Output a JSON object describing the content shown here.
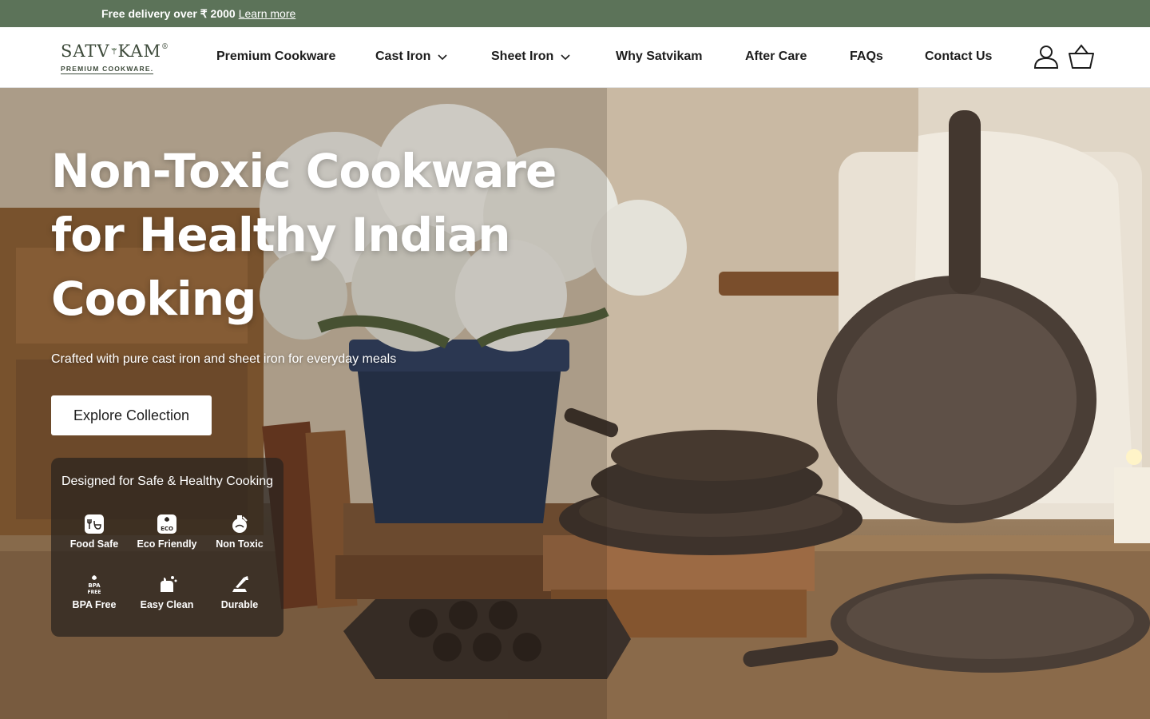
{
  "announcement": {
    "text": "Free delivery over ₹ 2000",
    "link": "Learn more"
  },
  "header": {
    "logo": {
      "name": "SATVIKAM",
      "tagline": "PREMIUM COOKWARE."
    },
    "nav": [
      {
        "label": "Premium Cookware",
        "has_dropdown": false
      },
      {
        "label": "Cast Iron",
        "has_dropdown": true
      },
      {
        "label": "Sheet Iron",
        "has_dropdown": true
      },
      {
        "label": "Why Satvikam",
        "has_dropdown": false
      },
      {
        "label": "After Care",
        "has_dropdown": false
      },
      {
        "label": "FAQs",
        "has_dropdown": false
      },
      {
        "label": "Contact Us",
        "has_dropdown": false
      }
    ],
    "icons": [
      "account-icon",
      "basket-icon"
    ]
  },
  "hero": {
    "title_lines": [
      "Non-Toxic Cookware",
      "for Healthy Indian",
      "Cooking"
    ],
    "subtitle": "Crafted with pure cast iron and sheet iron for everyday meals",
    "cta": "Explore Collection",
    "features": {
      "title": "Designed for Safe & Healthy Cooking",
      "items": [
        {
          "label": "Food Safe",
          "icon": "food-safe-icon",
          "icon_text": ""
        },
        {
          "label": "Eco Friendly",
          "icon": "eco-friendly-icon",
          "icon_text": "ECO"
        },
        {
          "label": "Non Toxic",
          "icon": "non-toxic-icon",
          "icon_text": ""
        },
        {
          "label": "BPA Free",
          "icon": "bpa-free-icon",
          "icon_text": "BPA FREE"
        },
        {
          "label": "Easy Clean",
          "icon": "easy-clean-icon",
          "icon_text": ""
        },
        {
          "label": "Durable",
          "icon": "durable-icon",
          "icon_text": ""
        }
      ]
    }
  },
  "colors": {
    "announcement_bg": "#5c7359",
    "logo": "#3d4a3a",
    "nav_text": "#1d1d1d",
    "badge_bg": "rgba(40,34,30,0.72)"
  }
}
